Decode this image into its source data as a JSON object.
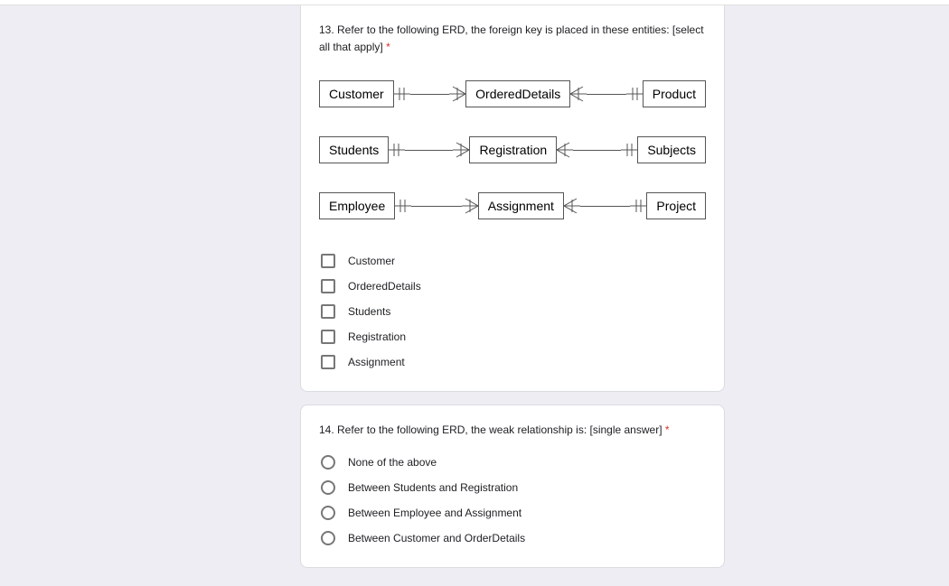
{
  "q13": {
    "text": "13. Refer to the following ERD, the foreign key is placed in these entities: [select all that apply]",
    "required": "*",
    "erd_rows": [
      {
        "left": "Customer",
        "mid": "OrderedDetails",
        "right": "Product"
      },
      {
        "left": "Students",
        "mid": "Registration",
        "right": "Subjects"
      },
      {
        "left": "Employee",
        "mid": "Assignment",
        "right": "Project"
      }
    ],
    "options": [
      "Customer",
      "OrderedDetails",
      "Students",
      "Registration",
      "Assignment"
    ]
  },
  "q14": {
    "text": "14. Refer to the following ERD, the weak relationship is: [single answer]",
    "required": "*",
    "options": [
      "None of the above",
      "Between Students and Registration",
      "Between Employee and Assignment",
      "Between Customer and OrderDetails"
    ]
  }
}
